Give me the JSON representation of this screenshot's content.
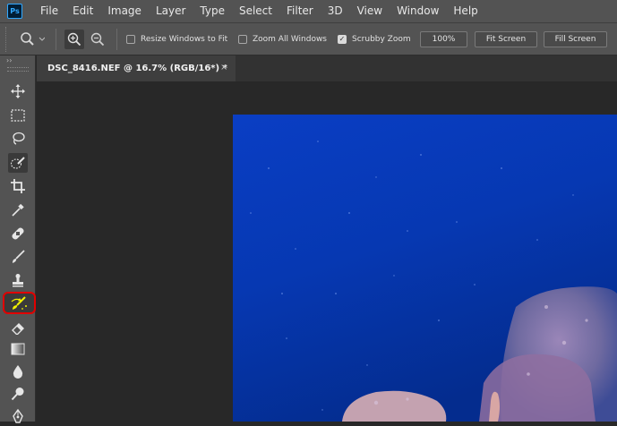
{
  "app": {
    "logo_text": "Ps"
  },
  "menu": [
    "File",
    "Edit",
    "Image",
    "Layer",
    "Type",
    "Select",
    "Filter",
    "3D",
    "View",
    "Window",
    "Help"
  ],
  "options_bar": {
    "resize_windows": {
      "label": "Resize Windows to Fit",
      "checked": false
    },
    "zoom_all": {
      "label": "Zoom All Windows",
      "checked": false
    },
    "scrubby_zoom": {
      "label": "Scrubby Zoom",
      "checked": true
    },
    "zoom_value": "100%",
    "fit_screen": "Fit Screen",
    "fill_screen": "Fill Screen"
  },
  "document_tab": {
    "title": "DSC_8416.NEF @ 16.7% (RGB/16*) *",
    "close": "×"
  },
  "toolbar": {
    "collapse_glyph": "››",
    "tools": [
      "move-tool",
      "marquee-tool",
      "lasso-tool",
      "quick-selection-tool",
      "crop-tool",
      "eyedropper-tool",
      "healing-brush-tool",
      "brush-tool",
      "clone-stamp-tool",
      "history-brush-tool",
      "eraser-tool",
      "gradient-tool",
      "blur-tool",
      "dodge-tool",
      "pen-tool"
    ],
    "active_tool": "history-brush-tool"
  },
  "colors": {
    "highlight": "#e00000",
    "photo_blue": "#0a3fbf",
    "panel": "#535353"
  }
}
